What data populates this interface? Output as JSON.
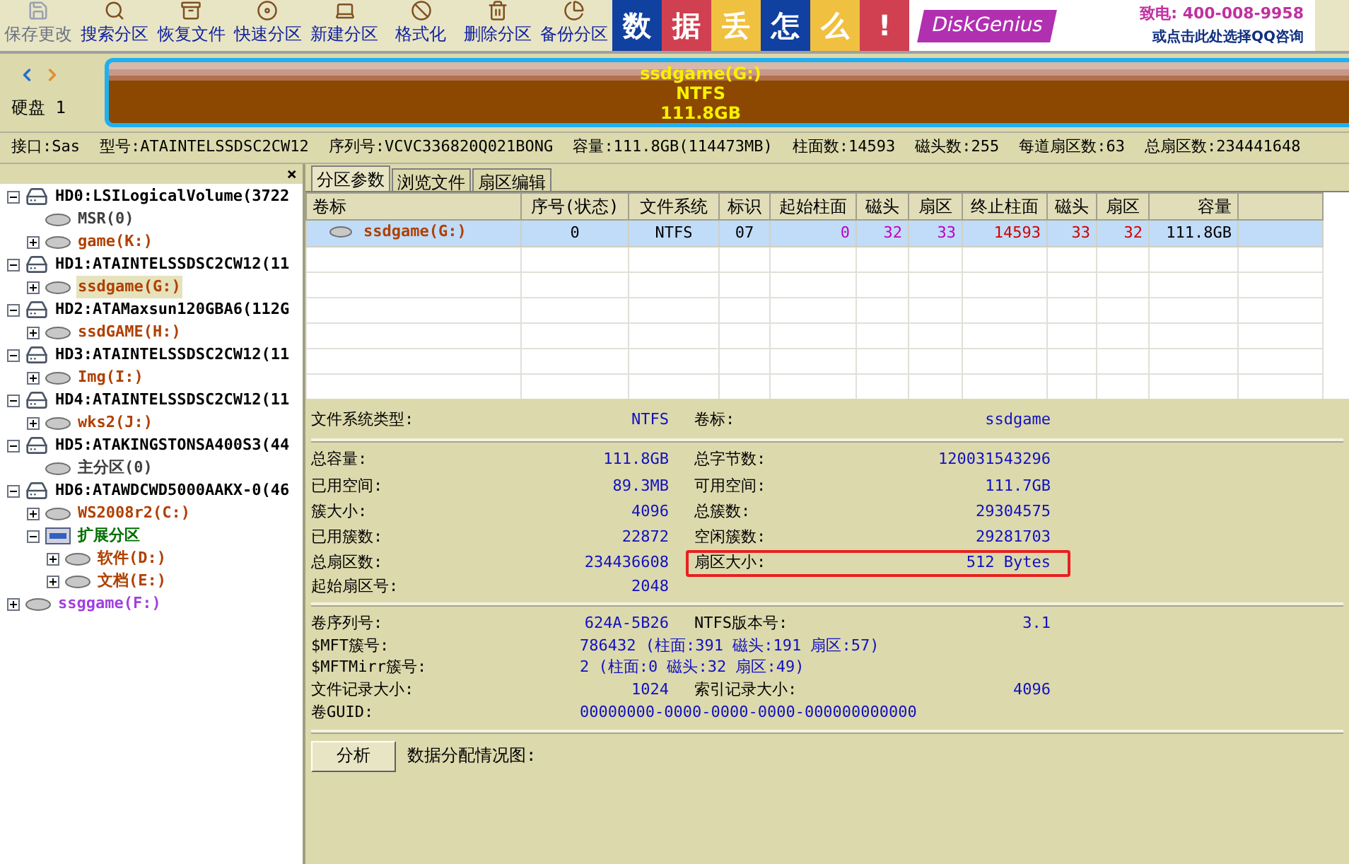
{
  "toolbar": [
    {
      "label": "保存更改",
      "disabled": true
    },
    {
      "label": "搜索分区",
      "disabled": false
    },
    {
      "label": "恢复文件",
      "disabled": false
    },
    {
      "label": "快速分区",
      "disabled": false
    },
    {
      "label": "新建分区",
      "disabled": false
    },
    {
      "label": "格式化",
      "disabled": false
    },
    {
      "label": "删除分区",
      "disabled": false
    },
    {
      "label": "备份分区",
      "disabled": false
    }
  ],
  "banner": {
    "tiles": [
      {
        "text": "数",
        "color": "#1040a0"
      },
      {
        "text": "据",
        "color": "#d04050"
      },
      {
        "text": "丢",
        "color": "#f0c040"
      },
      {
        "text": "怎",
        "color": "#1040a0"
      },
      {
        "text": "么",
        "color": "#f0c040"
      },
      {
        "text": "!",
        "color": "#d04050"
      }
    ],
    "brand": "DiskGenius",
    "phone": "致电: 400-008-9958",
    "link": "或点击此处选择QQ咨询"
  },
  "disk_bar": {
    "disk_label": "硬盘 1",
    "partition": {
      "name": "ssdgame(G:)",
      "filesystem": "NTFS",
      "size": "111.8GB"
    }
  },
  "disk_info": [
    "接口:Sas",
    "型号:ATAINTELSSDSC2CW12",
    "序列号:VCVC336820Q021BONG",
    "容量:111.8GB(114473MB)",
    "柱面数:14593",
    "磁头数:255",
    "每道扇区数:63",
    "总扇区数:234441648"
  ],
  "tree": {
    "close": "×",
    "nodes": [
      {
        "label": "HD0:LSILogicalVolume(3722",
        "kind": "disk",
        "color": "#000000",
        "expanded": true,
        "selected": false,
        "children": [
          {
            "label": "MSR(0)",
            "kind": "partition",
            "color": "#404040",
            "selected": false
          },
          {
            "label": "game(K:)",
            "kind": "partition",
            "color": "#b04000",
            "expanded": false,
            "selected": false
          }
        ]
      },
      {
        "label": "HD1:ATAINTELSSDSC2CW12(11",
        "kind": "disk",
        "color": "#000000",
        "expanded": true,
        "selected": false,
        "children": [
          {
            "label": "ssdgame(G:)",
            "kind": "partition",
            "color": "#b04000",
            "expanded": false,
            "selected": true
          }
        ]
      },
      {
        "label": "HD2:ATAMaxsun120GBA6(112G",
        "kind": "disk",
        "color": "#000000",
        "expanded": true,
        "selected": false,
        "children": [
          {
            "label": "ssdGAME(H:)",
            "kind": "partition",
            "color": "#b04000",
            "expanded": false,
            "selected": false
          }
        ]
      },
      {
        "label": "HD3:ATAINTELSSDSC2CW12(11",
        "kind": "disk",
        "color": "#000000",
        "expanded": true,
        "selected": false,
        "children": [
          {
            "label": "Img(I:)",
            "kind": "partition",
            "color": "#b04000",
            "expanded": false,
            "selected": false
          }
        ]
      },
      {
        "label": "HD4:ATAINTELSSDSC2CW12(11",
        "kind": "disk",
        "color": "#000000",
        "expanded": true,
        "selected": false,
        "children": [
          {
            "label": "wks2(J:)",
            "kind": "partition",
            "color": "#b04000",
            "expanded": false,
            "selected": false
          }
        ]
      },
      {
        "label": "HD5:ATAKINGSTONSA400S3(44",
        "kind": "disk",
        "color": "#000000",
        "expanded": true,
        "selected": false,
        "children": [
          {
            "label": "主分区(0)",
            "kind": "partition",
            "color": "#404040",
            "selected": false
          }
        ]
      },
      {
        "label": "HD6:ATAWDCWD5000AAKX-0(46",
        "kind": "disk",
        "color": "#000000",
        "expanded": true,
        "selected": false,
        "children": [
          {
            "label": "WS2008r2(C:)",
            "kind": "partition",
            "color": "#b04000",
            "expanded": false,
            "selected": false
          },
          {
            "label": "扩展分区",
            "kind": "extended",
            "color": "#007000",
            "expanded": true,
            "selected": false,
            "children": [
              {
                "label": "软件(D:)",
                "kind": "partition",
                "color": "#b04000",
                "expanded": false,
                "selected": false
              },
              {
                "label": "文档(E:)",
                "kind": "partition",
                "color": "#b04000",
                "expanded": false,
                "selected": false
              }
            ]
          }
        ]
      },
      {
        "label": "ssggame(F:)",
        "kind": "partition",
        "color": "#a040e0",
        "expanded": false,
        "selected": false
      }
    ]
  },
  "tabs": [
    {
      "label": "分区参数",
      "selected": true
    },
    {
      "label": "浏览文件",
      "selected": false
    },
    {
      "label": "扇区编辑",
      "selected": false
    }
  ],
  "table": {
    "columns": [
      "卷标",
      "序号(状态)",
      "文件系统",
      "标识",
      "起始柱面",
      "磁头",
      "扇区",
      "终止柱面",
      "磁头",
      "扇区",
      "容量"
    ],
    "rows": [
      {
        "selected": true,
        "cells": [
          {
            "text": "ssdgame(G:)",
            "color": "#b04000"
          },
          {
            "text": "0",
            "color": "#000000"
          },
          {
            "text": "NTFS",
            "color": "#000000"
          },
          {
            "text": "07",
            "color": "#000000"
          },
          {
            "text": "0",
            "color": "#c000c0"
          },
          {
            "text": "32",
            "color": "#c000c0"
          },
          {
            "text": "33",
            "color": "#c000c0"
          },
          {
            "text": "14593",
            "color": "#d00000"
          },
          {
            "text": "33",
            "color": "#d00000"
          },
          {
            "text": "32",
            "color": "#d00000"
          },
          {
            "text": "111.8GB",
            "color": "#000000"
          }
        ]
      }
    ]
  },
  "details": [
    [
      {
        "kind": "pair",
        "left": {
          "label": "文件系统类型:",
          "value": "NTFS"
        },
        "right": {
          "label": "卷标:",
          "value": "ssdgame",
          "highlighted": false
        }
      }
    ],
    [
      {
        "kind": "pair",
        "left": {
          "label": "总容量:",
          "value": "111.8GB"
        },
        "right": {
          "label": "总字节数:",
          "value": "120031543296",
          "highlighted": false
        }
      },
      {
        "kind": "pair",
        "left": {
          "label": "已用空间:",
          "value": "89.3MB"
        },
        "right": {
          "label": "可用空间:",
          "value": "111.7GB",
          "highlighted": false
        }
      },
      {
        "kind": "pair",
        "left": {
          "label": "簇大小:",
          "value": "4096"
        },
        "right": {
          "label": "总簇数:",
          "value": "29304575",
          "highlighted": false
        }
      },
      {
        "kind": "pair",
        "left": {
          "label": "已用簇数:",
          "value": "22872"
        },
        "right": {
          "label": "空闲簇数:",
          "value": "29281703",
          "highlighted": false
        }
      },
      {
        "kind": "pair",
        "left": {
          "label": "总扇区数:",
          "value": "234436608"
        },
        "right": {
          "label": "扇区大小:",
          "value": "512 Bytes",
          "highlighted": true
        }
      },
      {
        "kind": "pair",
        "left": {
          "label": "起始扇区号:",
          "value": "2048"
        }
      }
    ],
    [
      {
        "kind": "pair",
        "left": {
          "label": "卷序列号:",
          "value": "624A-5B26"
        },
        "right": {
          "label": "NTFS版本号:",
          "value": "3.1",
          "highlighted": false
        }
      },
      {
        "kind": "wide",
        "label": "$MFT簇号:",
        "value": "786432 (柱面:391 磁头:191 扇区:57)"
      },
      {
        "kind": "wide",
        "label": "$MFTMirr簇号:",
        "value": "2 (柱面:0 磁头:32 扇区:49)"
      },
      {
        "kind": "pair",
        "left": {
          "label": "文件记录大小:",
          "value": "1024"
        },
        "right": {
          "label": "索引记录大小:",
          "value": "4096",
          "highlighted": false
        }
      },
      {
        "kind": "wide",
        "label": "卷GUID:",
        "value": "00000000-0000-0000-0000-000000000000"
      }
    ]
  ],
  "analyze": {
    "button": "分析",
    "label": "数据分配情况图:"
  }
}
